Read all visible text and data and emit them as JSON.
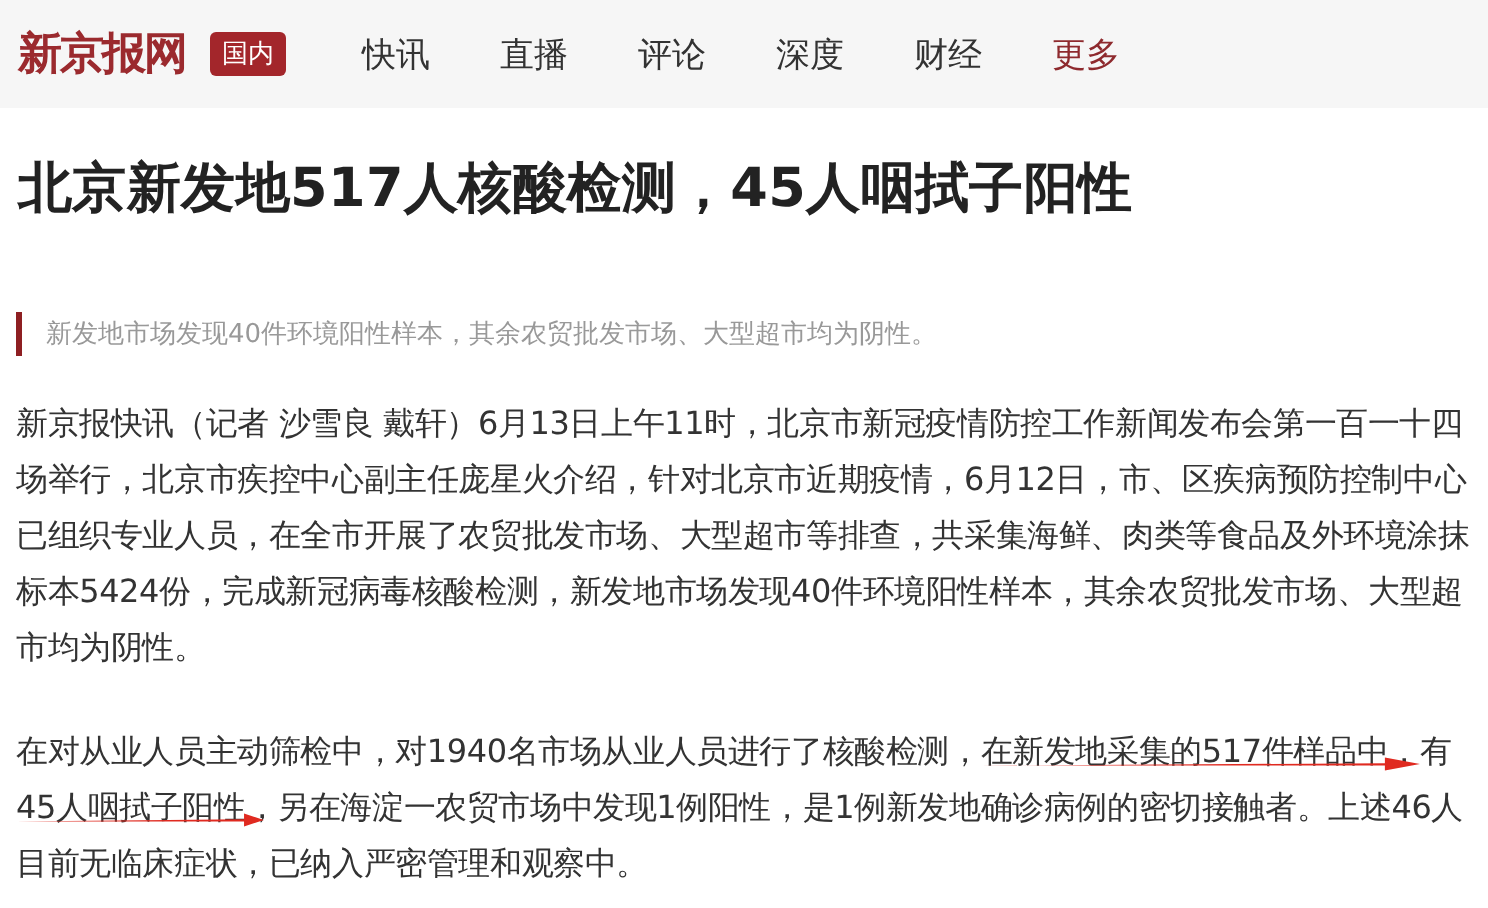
{
  "header": {
    "logo": "新京报网",
    "section_tag": "国内",
    "nav": [
      {
        "label": "快讯",
        "selected": false
      },
      {
        "label": "直播",
        "selected": false
      },
      {
        "label": "评论",
        "selected": false
      },
      {
        "label": "深度",
        "selected": false
      },
      {
        "label": "财经",
        "selected": false
      },
      {
        "label": "更多",
        "selected": true
      }
    ]
  },
  "article": {
    "title": "北京新发地517人核酸检测，45人咽拭子阳性",
    "summary": "新发地市场发现40件环境阳性样本，其余农贸批发市场、大型超市均为阴性。",
    "paragraphs": [
      [
        {
          "text": "新京报快讯（记者 沙雪良 戴轩）6月13日上午11时，北京市新冠疫情防控工作新闻发布会第一百一十四场举行，北京市疾控中心副主任庞星火介绍，针对北京市近期疫情，6月12日，市、区疾病预防控制中心已组织专业人员，在全市开展了农贸批发市场、大型超市等排查，共采集海鲜、肉类等食品及外环境涂抹标本5424份，完成新冠病毒核酸检测，新发地市场发现40件环境阳性样本，其余农贸批发市场、大型超市均为阴性。",
          "marked": false
        }
      ],
      [
        {
          "text": "在对从业人员主动筛检中，对1940名市场从业人员进行了核酸检测，",
          "marked": false
        },
        {
          "text": "在新发地采集的517件样品中",
          "marked": true
        },
        {
          "text": "，有",
          "marked": false
        },
        {
          "text": "45人咽拭子阳性",
          "marked": true
        },
        {
          "text": "，另在海淀一农贸市场中发现1例阳性，是1例新发地确诊病例的密切接触者。上述46人目前无临床症状，已纳入严密管理和观察中。",
          "marked": false
        }
      ]
    ]
  }
}
